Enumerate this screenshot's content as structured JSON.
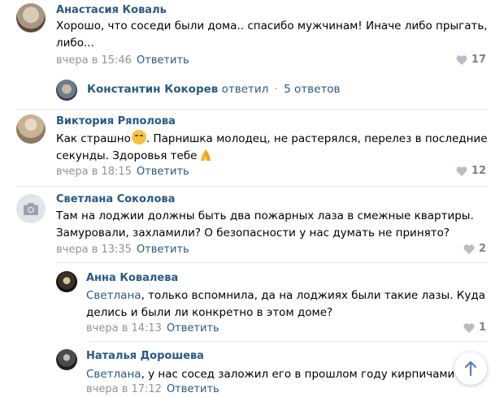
{
  "comments": [
    {
      "author": "Анастасия Коваль",
      "text": "Хорошо, что соседи были дома.. спасибо мужчинам! Иначе либо прыгать, либо...",
      "time": "вчера в 15:46",
      "reply_label": "Ответить",
      "likes": "17"
    },
    {
      "author": "Виктория Ряполова",
      "text_part1": "Как страшно",
      "text_part2": ". Парнишка молодец, не растерялся, перелез в последние секунды. Здоровья тебе",
      "time": "вчера в 18:15",
      "reply_label": "Ответить",
      "likes": "12"
    },
    {
      "author": "Светлана Соколова",
      "text": "Там на лоджии должны быть два пожарных лаза в смежные квартиры. Замуровали, захламили? О безопасности у нас думать не принято?",
      "time": "вчера в 13:35",
      "reply_label": "Ответить",
      "likes": "2"
    }
  ],
  "thread": {
    "author": "Константин Кокорев",
    "action": "ответил",
    "dot": "·",
    "count": "5 ответов"
  },
  "replies": [
    {
      "author": "Анна Ковалева",
      "mention": "Светлана",
      "text": ", только вспомнила, да на лоджиях были такие лазы. Куда делись и были ли конкретно в этом доме?",
      "time": "вчера в 14:13",
      "reply_label": "Ответить",
      "likes": "1"
    },
    {
      "author": "Наталья Дорошева",
      "mention": "Светлана",
      "text": ", у нас сосед заложил его в прошлом году кирпичами",
      "time": "вчера в 17:12",
      "reply_label": "Ответить"
    }
  ],
  "colors": {
    "link": "#2a5885",
    "meta": "#939393",
    "like": "#828282"
  },
  "icons": [
    "heart-icon",
    "camera-icon",
    "arrow-up-icon",
    "worried-emoji-icon",
    "pray-emoji-icon"
  ]
}
